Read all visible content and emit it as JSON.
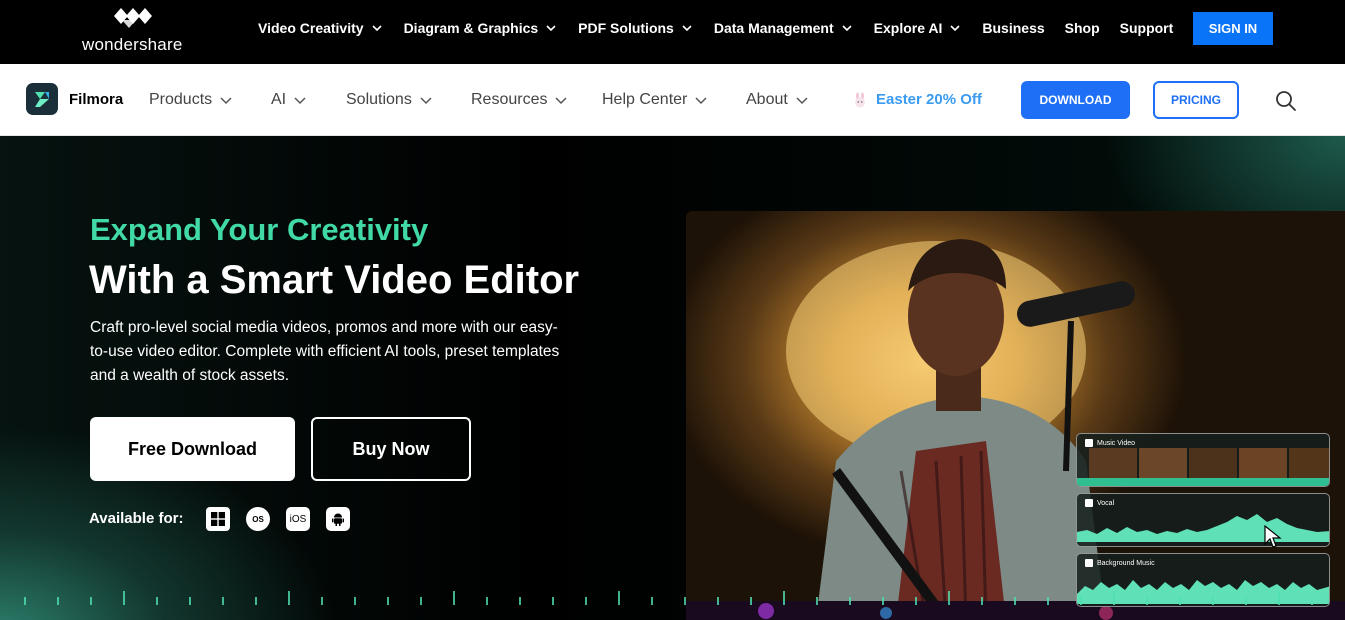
{
  "brand": {
    "wondershare": "wondershare",
    "filmora": "Filmora"
  },
  "topnav": {
    "items": [
      {
        "label": "Video Creativity",
        "dropdown": true
      },
      {
        "label": "Diagram & Graphics",
        "dropdown": true
      },
      {
        "label": "PDF Solutions",
        "dropdown": true
      },
      {
        "label": "Data Management",
        "dropdown": true
      },
      {
        "label": "Explore AI",
        "dropdown": true
      },
      {
        "label": "Business",
        "dropdown": false
      },
      {
        "label": "Shop",
        "dropdown": false
      },
      {
        "label": "Support",
        "dropdown": false
      }
    ],
    "signin_label": "SIGN IN"
  },
  "prodnav": {
    "items": [
      "Products",
      "AI",
      "Solutions",
      "Resources",
      "Help Center",
      "About"
    ],
    "promo": "Easter 20% Off",
    "download_label": "DOWNLOAD",
    "pricing_label": "PRICING"
  },
  "hero": {
    "kicker": "Expand Your Creativity",
    "headline": "With a Smart Video Editor",
    "description": "Craft pro-level social media videos, promos and more with our easy-to-use video editor. Complete with efficient AI tools, preset templates and a wealth of stock assets.",
    "free_download_label": "Free Download",
    "buy_now_label": "Buy Now",
    "available_label": "Available for:",
    "platforms": [
      {
        "name": "windows-icon",
        "text": ""
      },
      {
        "name": "macos-icon",
        "text": "OS"
      },
      {
        "name": "ios-icon",
        "text": "iOS"
      },
      {
        "name": "android-icon",
        "text": ""
      }
    ]
  },
  "tracks": [
    "Music Video",
    "Vocal",
    "Background Music"
  ],
  "colors": {
    "accent_blue": "#1e6ff5",
    "signin_blue": "#0a74f8",
    "kicker_green": "#41d9a6",
    "promo_blue": "#3a9bf0"
  }
}
